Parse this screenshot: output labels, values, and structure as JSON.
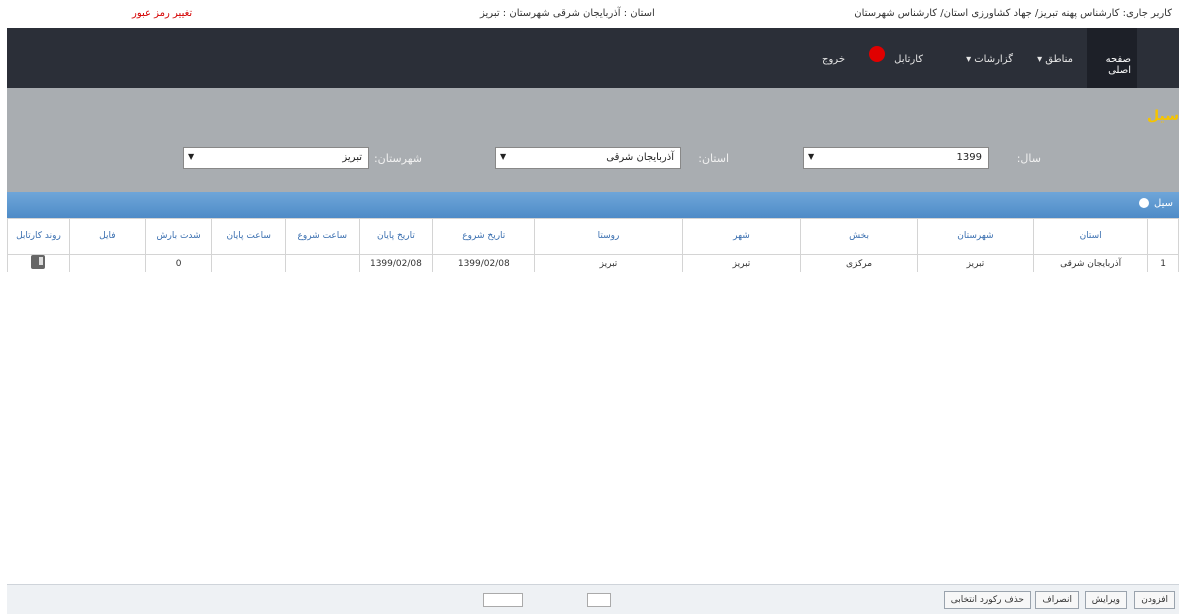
{
  "topbar": {
    "user": "کاربر جاری: کارشناس پهنه تبریز/ جهاد کشاورزی استان/ کارشناس شهرستان",
    "location": "استان : آذربایجان شرقی شهرستان : تبریز",
    "change_password": "تغییر رمز عبور"
  },
  "nav": {
    "home": "صفحه اصلی",
    "items": [
      "مناطق",
      "گزارشات",
      "کارتابل",
      "خروج"
    ]
  },
  "filters": {
    "title": "سیل",
    "year_label": "سال:",
    "year_value": "1399",
    "province_label": "استان:",
    "province_value": "آذربایجان شرقی",
    "county_label": "شهرستان:",
    "county_value": "تبریز"
  },
  "grid": {
    "title": "سیل",
    "columns": [
      "",
      "استان",
      "شهرستان",
      "بخش",
      "شهر",
      "روستا",
      "تاریخ شروع",
      "تاریخ پایان",
      "ساعت شروع",
      "ساعت پایان",
      "شدت بارش",
      "فایل",
      "روند کارتابل"
    ],
    "rows": [
      [
        "1",
        "آذربایجان شرقی",
        "تبریز",
        "مرکزی",
        "تبریز",
        "تبریز",
        "1399/02/08",
        "1399/02/08",
        "",
        "",
        "0",
        "",
        ""
      ]
    ]
  },
  "footer": {
    "buttons": [
      "افزودن",
      "ویرایش",
      "انصراف",
      "حذف رکورد انتخابی"
    ]
  }
}
